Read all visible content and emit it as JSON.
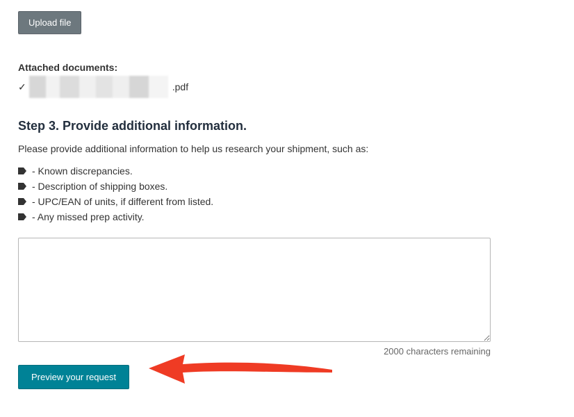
{
  "upload": {
    "button_label": "Upload file"
  },
  "attached": {
    "heading": "Attached documents:",
    "checkmark": "✓",
    "filename_obscured": true,
    "extension": ".pdf"
  },
  "step3": {
    "title": "Step 3. Provide additional information.",
    "description": "Please provide additional information to help us research your shipment, such as:",
    "bullets": [
      "- Known discrepancies.",
      "- Description of shipping boxes.",
      "- UPC/EAN of units, if different from listed.",
      "- Any missed prep activity."
    ]
  },
  "textarea": {
    "value": "",
    "remaining_text": "2000 characters remaining"
  },
  "preview": {
    "button_label": "Preview your request"
  },
  "annotation": {
    "arrow_color": "#ef3b24"
  }
}
